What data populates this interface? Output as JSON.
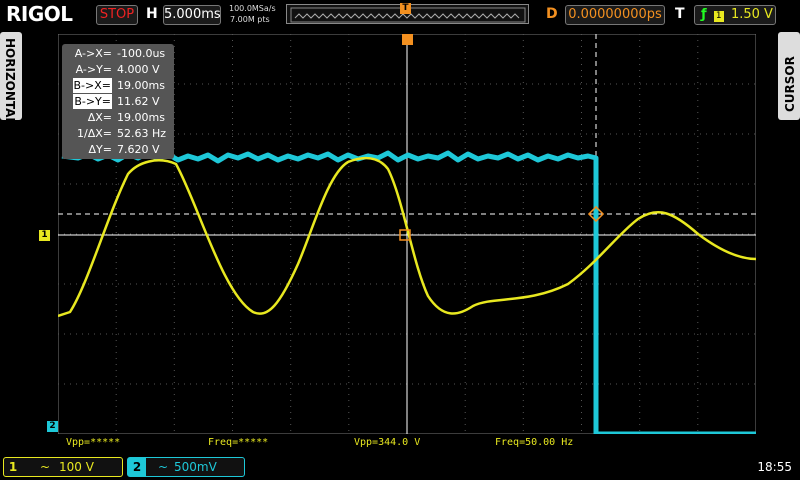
{
  "top": {
    "logo": "RIGOL",
    "run_state": "STOP",
    "h_label": "H",
    "timebase": "5.000ms",
    "sample_rate": "100.0MSa/s",
    "mem_depth": "7.00M pts",
    "d_label": "D",
    "delay": "0.00000000ps",
    "t_label": "T",
    "trigger_icon": "rising-edge-icon",
    "trigger_source": "1",
    "trigger_level": "1.50 V"
  },
  "side": {
    "left": "HORIZONTAL",
    "right": "CURSOR"
  },
  "cursor": {
    "rows": [
      {
        "label": "A->X=",
        "value": "-100.0us"
      },
      {
        "label": "A->Y=",
        "value": "4.000 V"
      },
      {
        "label": "B->X=",
        "value": "19.00ms"
      },
      {
        "label": "B->Y=",
        "value": "11.62 V"
      },
      {
        "label": "ΔX=",
        "value": "19.00ms"
      },
      {
        "label": "1/ΔX=",
        "value": "52.63 Hz"
      },
      {
        "label": "ΔY=",
        "value": "7.620 V"
      }
    ]
  },
  "measurements": {
    "vpp2": "Vpp=*****",
    "freq2": "Freq=*****",
    "vpp1": "Vpp=344.0 V",
    "freq1": "Freq=50.00 Hz"
  },
  "markers": {
    "ch1": "1",
    "ch2": "2",
    "trigger": "T"
  },
  "channels": {
    "ch1": {
      "num": "1",
      "coupling": "~",
      "scale": "100 V"
    },
    "ch2": {
      "num": "2",
      "coupling": "~",
      "scale": "500mV"
    }
  },
  "clock": "18:55",
  "colors": {
    "ch1": "#e8e820",
    "ch2": "#1ec8d8",
    "trigger": "#f39020",
    "stop": "#e22222"
  }
}
